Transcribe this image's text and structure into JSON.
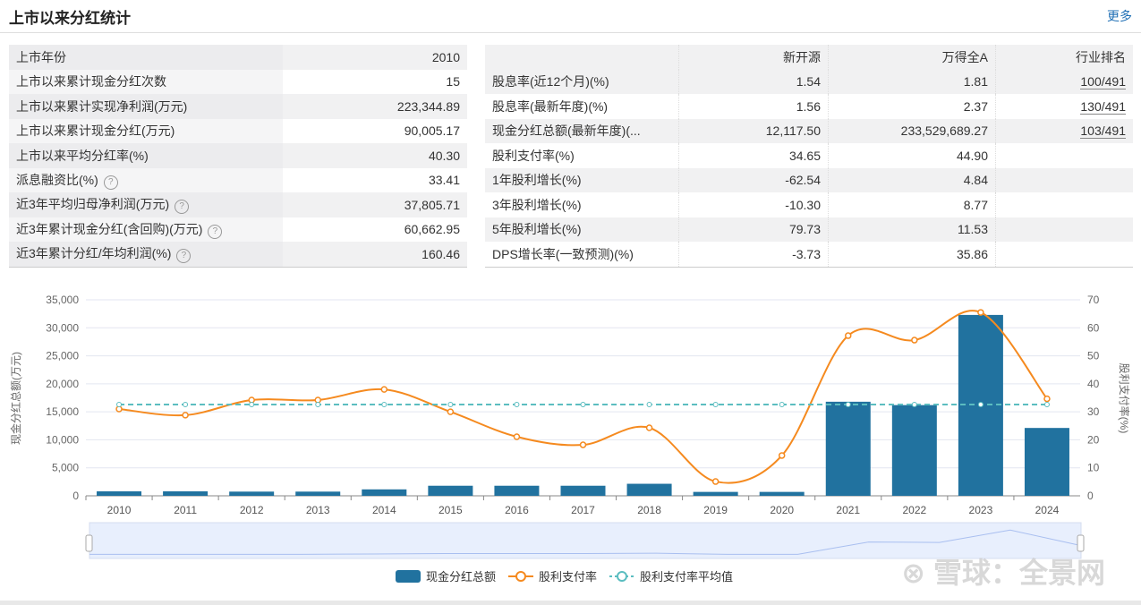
{
  "header": {
    "title": "上市以来分红统计",
    "more": "更多"
  },
  "left_table": [
    {
      "label": "上市年份",
      "value": "2010",
      "help": false
    },
    {
      "label": "上市以来累计现金分红次数",
      "value": "15",
      "help": false
    },
    {
      "label": "上市以来累计实现净利润(万元)",
      "value": "223,344.89",
      "help": false
    },
    {
      "label": "上市以来累计现金分红(万元)",
      "value": "90,005.17",
      "help": false
    },
    {
      "label": "上市以来平均分红率(%)",
      "value": "40.30",
      "help": false
    },
    {
      "label": "派息融资比(%)",
      "value": "33.41",
      "help": true
    },
    {
      "label": "近3年平均归母净利润(万元)",
      "value": "37,805.71",
      "help": true
    },
    {
      "label": "近3年累计现金分红(含回购)(万元)",
      "value": "60,662.95",
      "help": true
    },
    {
      "label": "近3年累计分红/年均利润(%)",
      "value": "160.46",
      "help": true
    }
  ],
  "right_table": {
    "headers": [
      "",
      "新开源",
      "万得全A",
      "行业排名"
    ],
    "rows": [
      [
        "股息率(近12个月)(%)",
        "1.54",
        "1.81",
        "100/491"
      ],
      [
        "股息率(最新年度)(%)",
        "1.56",
        "2.37",
        "130/491"
      ],
      [
        "现金分红总额(最新年度)(...",
        "12,117.50",
        "233,529,689.27",
        "103/491"
      ],
      [
        "股利支付率(%)",
        "34.65",
        "44.90",
        ""
      ],
      [
        "1年股利增长(%)",
        "-62.54",
        "4.84",
        ""
      ],
      [
        "3年股利增长(%)",
        "-10.30",
        "8.77",
        ""
      ],
      [
        "5年股利增长(%)",
        "79.73",
        "11.53",
        ""
      ],
      [
        "DPS增长率(一致预测)(%)",
        "-3.73",
        "35.86",
        ""
      ]
    ]
  },
  "chart_data": {
    "type": "bar+line",
    "categories": [
      "2010",
      "2011",
      "2012",
      "2013",
      "2014",
      "2015",
      "2016",
      "2017",
      "2018",
      "2019",
      "2020",
      "2021",
      "2022",
      "2023",
      "2024"
    ],
    "series": [
      {
        "name": "现金分红总额",
        "type": "bar",
        "axis": "left",
        "color": "#21729f",
        "values": [
          800,
          800,
          750,
          750,
          1150,
          1800,
          1800,
          1800,
          2150,
          700,
          700,
          16800,
          16200,
          32300,
          12117.5
        ]
      },
      {
        "name": "股利支付率",
        "type": "line",
        "axis": "right",
        "color": "#f58a1f",
        "values": [
          31.0,
          28.8,
          34.2,
          34.2,
          38.0,
          30.0,
          21.1,
          18.2,
          24.3,
          5.1,
          14.4,
          57.2,
          55.6,
          65.5,
          34.65
        ]
      },
      {
        "name": "股利支付率平均值",
        "type": "line",
        "axis": "right",
        "color": "#5bbdc0",
        "dashed": true,
        "values": [
          32.6,
          32.6,
          32.6,
          32.6,
          32.6,
          32.6,
          32.6,
          32.6,
          32.6,
          32.6,
          32.6,
          32.6,
          32.6,
          32.6,
          32.6
        ]
      }
    ],
    "ylabel": "现金分红总额(万元)",
    "y2label": "股利支付率(%)",
    "ylim": [
      0,
      35000
    ],
    "yticks": [
      "0",
      "5,000",
      "10,000",
      "15,000",
      "20,000",
      "25,000",
      "30,000",
      "35,000"
    ],
    "y2lim": [
      0,
      70
    ],
    "y2ticks": [
      "0",
      "10",
      "20",
      "30",
      "40",
      "50",
      "60",
      "70"
    ],
    "legend": "bottom-center"
  },
  "watermark": "雪球：全景网"
}
